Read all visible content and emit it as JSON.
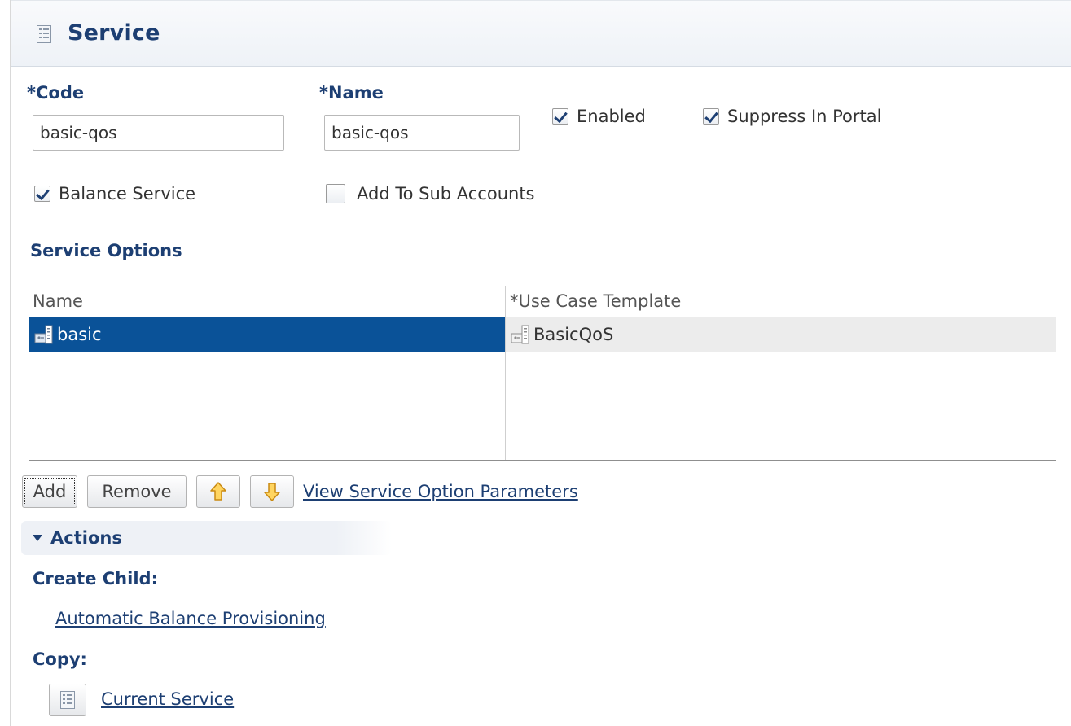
{
  "header": {
    "title": "Service",
    "icon": "list-form-icon"
  },
  "form": {
    "code_label": "*Code",
    "code_value": "basic-qos",
    "name_label": "*Name",
    "name_value": "basic-qos",
    "enabled_label": "Enabled",
    "enabled_checked": true,
    "suppress_label": "Suppress In Portal",
    "suppress_checked": true,
    "balance_label": "Balance Service",
    "balance_checked": true,
    "subaccounts_label": "Add To Sub Accounts",
    "subaccounts_checked": false
  },
  "service_options": {
    "title": "Service Options",
    "columns": [
      "Name",
      "*Use Case Template"
    ],
    "rows": [
      {
        "name": "basic",
        "template": "BasicQoS",
        "selected": true
      }
    ]
  },
  "toolbar": {
    "add_label": "Add",
    "remove_label": "Remove",
    "move_up_icon": "arrow-up-icon",
    "move_down_icon": "arrow-down-icon",
    "view_params_label": "View Service Option Parameters"
  },
  "actions": {
    "title": "Actions",
    "create_child_label": "Create Child:",
    "create_child_link": "Automatic Balance Provisioning",
    "copy_label": "Copy:",
    "copy_link": "Current Service"
  },
  "colors": {
    "title_blue": "#1d3f73",
    "selection_blue": "#0a5298",
    "arrow_orange": "#f2b01e"
  }
}
